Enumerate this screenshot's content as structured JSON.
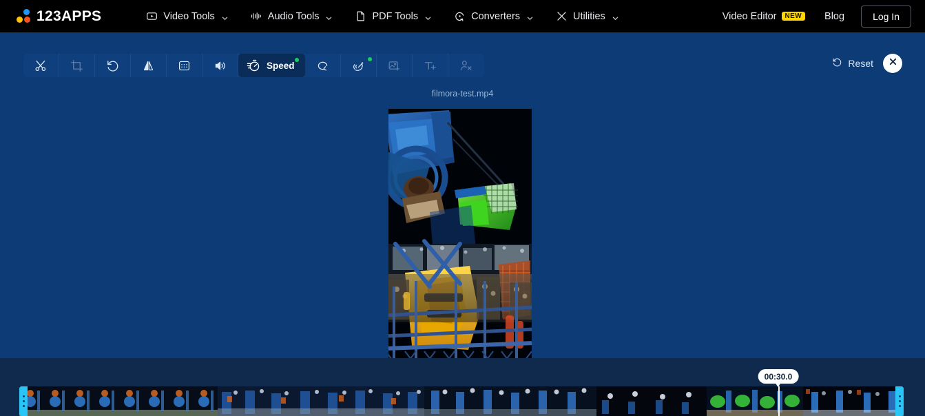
{
  "header": {
    "logo_text": "123APPS",
    "logo_colors": {
      "blue": "#2196f3",
      "yellow": "#ffc107",
      "orange": "#f4511e"
    },
    "nav": [
      {
        "label": "Video Tools",
        "icon": "video-play-icon",
        "has_chevron": true
      },
      {
        "label": "Audio Tools",
        "icon": "audio-wave-icon",
        "has_chevron": true
      },
      {
        "label": "PDF Tools",
        "icon": "document-icon",
        "has_chevron": true
      },
      {
        "label": "Converters",
        "icon": "convert-circle-icon",
        "has_chevron": true
      },
      {
        "label": "Utilities",
        "icon": "tools-cross-icon",
        "has_chevron": true
      }
    ],
    "video_editor_label": "Video Editor",
    "new_badge": "NEW",
    "blog_label": "Blog",
    "login_label": "Log In"
  },
  "toolbar": {
    "items": [
      {
        "label": "",
        "icon": "scissors-icon",
        "name": "cut",
        "state": "enabled"
      },
      {
        "label": "",
        "icon": "crop-icon",
        "name": "crop",
        "state": "disabled"
      },
      {
        "label": "",
        "icon": "rotate-ccw-icon",
        "name": "rotate",
        "state": "enabled"
      },
      {
        "label": "",
        "icon": "flip-icon",
        "name": "flip",
        "state": "enabled"
      },
      {
        "label": "",
        "icon": "frame-icon",
        "name": "frame",
        "state": "enabled"
      },
      {
        "label": "",
        "icon": "volume-icon",
        "name": "volume",
        "state": "enabled"
      },
      {
        "label": "Speed",
        "icon": "stopwatch-speed-icon",
        "name": "speed",
        "state": "active",
        "badge": true
      },
      {
        "label": "",
        "icon": "loop-icon",
        "name": "loop",
        "state": "enabled"
      },
      {
        "label": "",
        "icon": "wave-effects-icon",
        "name": "effects",
        "state": "enabled",
        "badge": true
      },
      {
        "label": "",
        "icon": "add-image-icon",
        "name": "add-image",
        "state": "disabled"
      },
      {
        "label": "",
        "icon": "add-text-icon",
        "name": "add-text",
        "state": "disabled"
      },
      {
        "label": "",
        "icon": "remove-watermark-icon",
        "name": "remove-watermark",
        "state": "disabled"
      }
    ],
    "reset_label": "Reset",
    "reset_icon": "rotate-ccw-icon",
    "close_icon": "close-icon",
    "accent_badge_color": "#15d05c"
  },
  "preview": {
    "filename": "filmora-test.mp4"
  },
  "timeline": {
    "current_time": "00:30.0",
    "trim_handle_color": "#29c5f6",
    "playhead_color": "#ffffff"
  }
}
